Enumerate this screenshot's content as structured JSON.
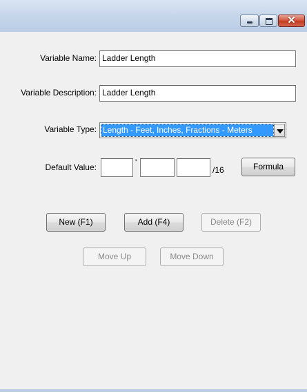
{
  "window": {
    "buttons": {
      "minimize_icon": "minimize-icon",
      "maximize_icon": "maximize-icon",
      "close_icon": "close-icon",
      "close_glyph": "✕"
    }
  },
  "form": {
    "variable_name": {
      "label": "Variable Name:",
      "value": "Ladder Length"
    },
    "variable_description": {
      "label": "Variable Description:",
      "value": "Ladder Length"
    },
    "variable_type": {
      "label": "Variable Type:",
      "selected": "Length - Feet, Inches, Fractions - Meters"
    },
    "default_value": {
      "label": "Default Value:",
      "feet": "",
      "inches": "",
      "fraction_numerator": "",
      "feet_mark": "'",
      "fraction_denominator": "/16",
      "formula_button": "Formula"
    }
  },
  "actions": {
    "new_button": "New (F1)",
    "add_button": "Add (F4)",
    "delete_button": "Delete (F2)",
    "move_up_button": "Move Up",
    "move_down_button": "Move Down"
  },
  "colors": {
    "selection": "#3399ff",
    "title_bar": "#c6d6ea",
    "close_button": "#c53b22",
    "background": "#f0f0f0"
  }
}
